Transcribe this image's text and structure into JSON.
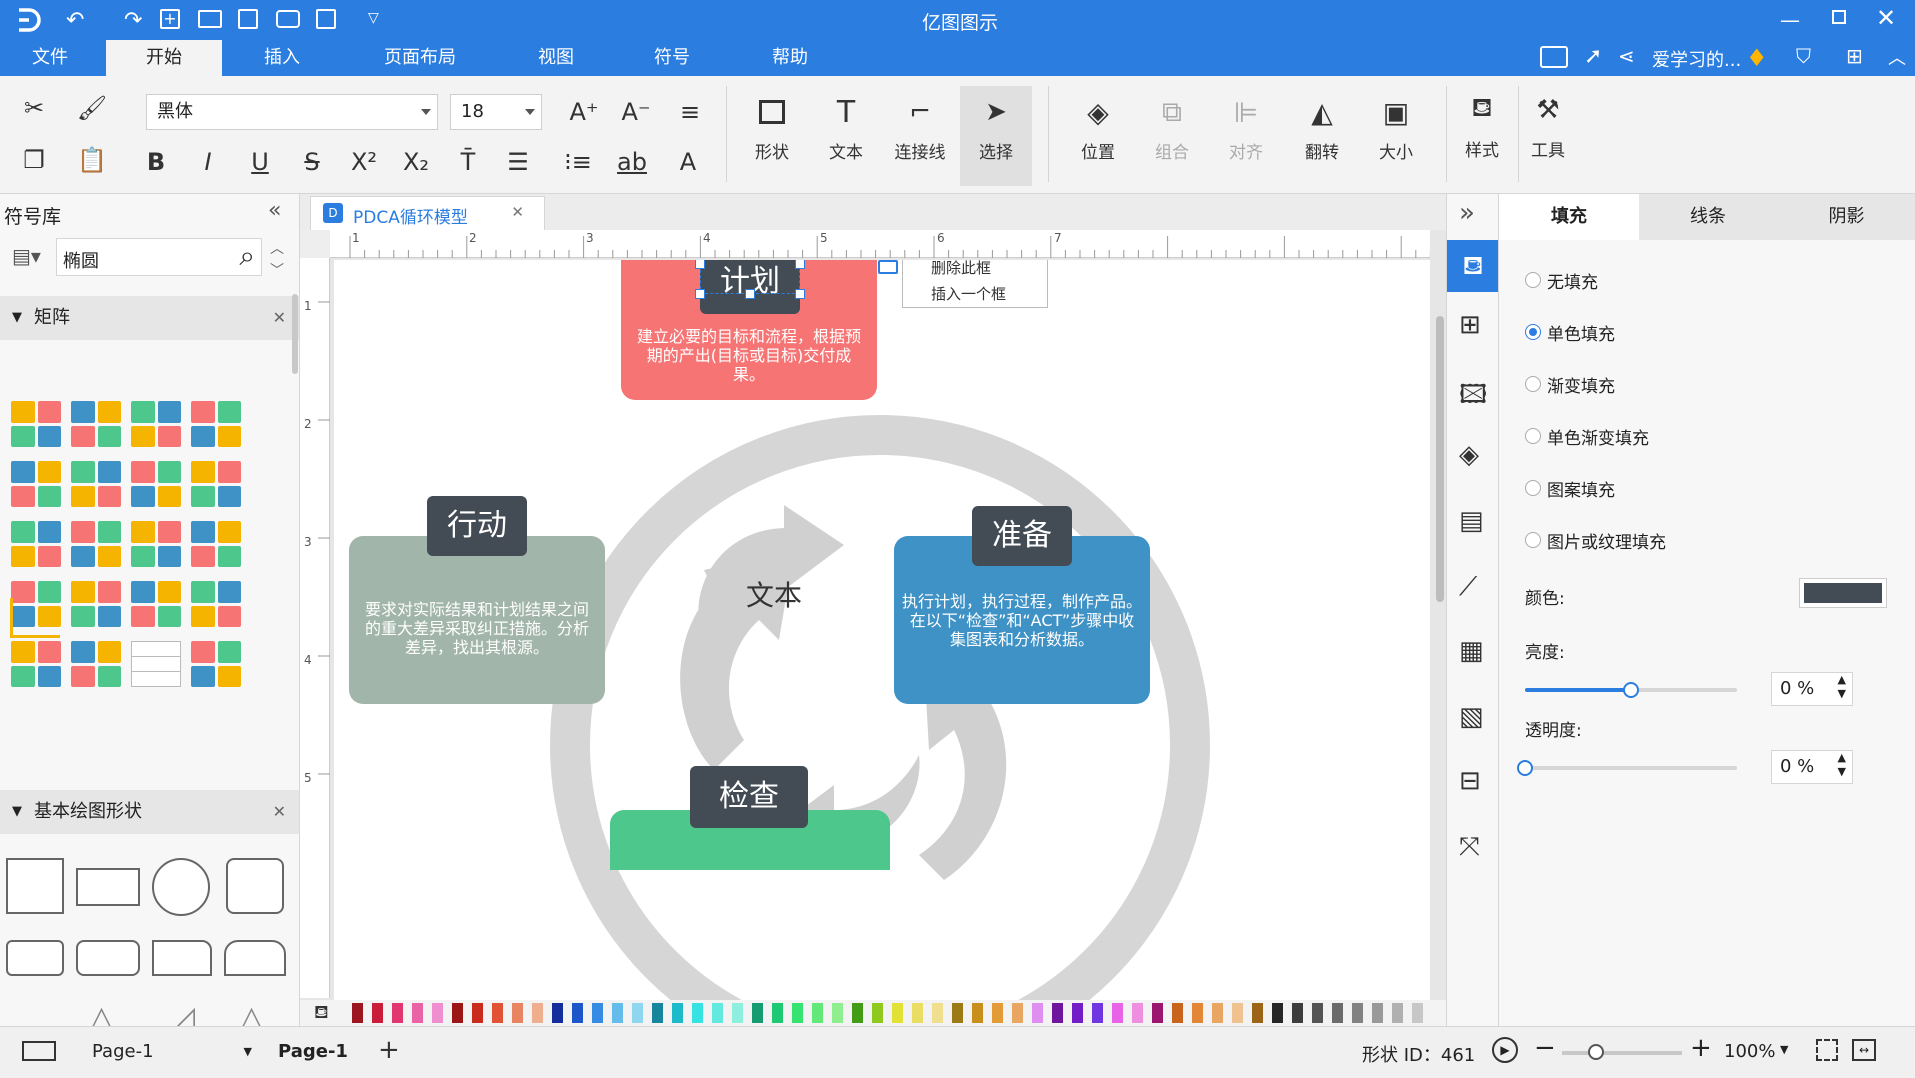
{
  "app": {
    "title": "亿图图示",
    "user_name": "爱学习的...",
    "window_controls": [
      "minimize-icon",
      "restore-icon",
      "close-icon"
    ]
  },
  "menu": {
    "items": [
      "文件",
      "开始",
      "插入",
      "页面布局",
      "视图",
      "符号",
      "帮助"
    ],
    "active": "开始"
  },
  "ribbon": {
    "font_name": "黑体",
    "font_size": "18",
    "tools": {
      "shape": "形状",
      "text": "文本",
      "connector": "连接线",
      "select": "选择",
      "position": "位置",
      "group": "组合",
      "align": "对齐",
      "flip": "翻转",
      "size": "大小",
      "style": "样式",
      "tools": "工具"
    }
  },
  "left_panel": {
    "title": "符号库",
    "search_value": "椭圆",
    "section_matrix": "矩阵",
    "section_basic": "基本绘图形状"
  },
  "document": {
    "tab_title": "PDCA循环模型",
    "ruler_h": [
      "1",
      "2",
      "3",
      "4",
      "5",
      "6",
      "7"
    ],
    "ruler_v": [
      "1",
      "2",
      "3",
      "4",
      "5"
    ]
  },
  "diagram": {
    "plan_title": "计划",
    "plan_text": "建立必要的目标和流程，根据预期的产出(目标或目标)交付成果。",
    "do_title": "准备",
    "do_text": "执行计划，执行过程，制作产品。在以下“检查”和“ACT”步骤中收集图表和分析数据。",
    "check_title": "检查",
    "act_title": "行动",
    "act_text": "要求对实际结果和计划结果之间的重大差异采取纠正措施。分析差异，找出其根源。",
    "center_text": "文本",
    "context_menu": [
      "删除此框",
      "插入一个框"
    ],
    "colors": {
      "plan": "#f77474",
      "do": "#3f92c6",
      "check": "#4dc78b",
      "act": "#a2b5aa",
      "title_box": "#434c55",
      "ring": "#d6d6d6"
    }
  },
  "right_panel": {
    "tabs": [
      "填充",
      "线条",
      "阴影"
    ],
    "active_tab": "填充",
    "fill_options": [
      "无填充",
      "单色填充",
      "渐变填充",
      "单色渐变填充",
      "图案填充",
      "图片或纹理填充"
    ],
    "selected_option": "单色填充",
    "color_label": "颜色:",
    "color_value": "#434c55",
    "brightness_label": "亮度:",
    "brightness_value": "0 %",
    "brightness_level": 0.5,
    "transparency_label": "透明度:",
    "transparency_value": "0 %",
    "transparency_level": 0
  },
  "status": {
    "page_dropdown": "Page-1",
    "page_tab": "Page-1",
    "shape_id": "形状 ID：461",
    "zoom": "100%"
  }
}
